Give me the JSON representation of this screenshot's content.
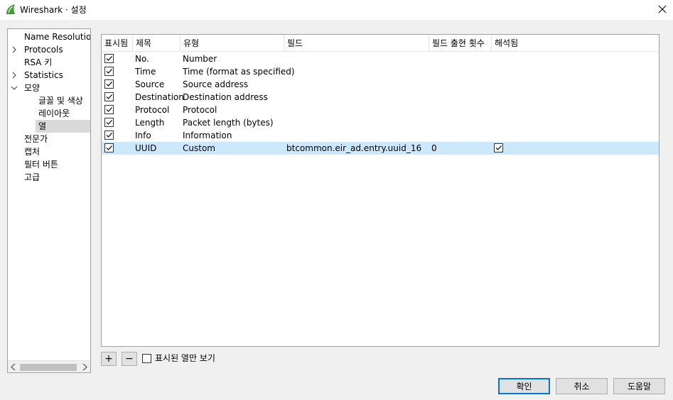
{
  "window": {
    "title": "Wireshark · 설정"
  },
  "tree": {
    "items": [
      {
        "label": "Name Resolution",
        "level": 0,
        "expander": "none",
        "selected": false
      },
      {
        "label": "Protocols",
        "level": 0,
        "expander": "collapsed",
        "selected": false
      },
      {
        "label": "RSA 키",
        "level": 0,
        "expander": "none",
        "selected": false
      },
      {
        "label": "Statistics",
        "level": 0,
        "expander": "collapsed",
        "selected": false
      },
      {
        "label": "모양",
        "level": 0,
        "expander": "expanded",
        "selected": false
      },
      {
        "label": "글꼴 및 색상",
        "level": 1,
        "expander": "none",
        "selected": false
      },
      {
        "label": "레이아웃",
        "level": 1,
        "expander": "none",
        "selected": false
      },
      {
        "label": "열",
        "level": 1,
        "expander": "none",
        "selected": true
      },
      {
        "label": "전문가",
        "level": 0,
        "expander": "none",
        "selected": false
      },
      {
        "label": "캡처",
        "level": 0,
        "expander": "none",
        "selected": false
      },
      {
        "label": "필터 버튼",
        "level": 0,
        "expander": "none",
        "selected": false
      },
      {
        "label": "고급",
        "level": 0,
        "expander": "none",
        "selected": false
      }
    ]
  },
  "columns_table": {
    "headers": [
      "표시됨",
      "제목",
      "유형",
      "필드",
      "필드 출현 횟수",
      "해석됨"
    ],
    "rows": [
      {
        "shown": true,
        "title": "No.",
        "type": "Number",
        "fields": "",
        "occurrence": "",
        "resolved": null,
        "selected": false
      },
      {
        "shown": true,
        "title": "Time",
        "type": "Time (format as specified)",
        "fields": "",
        "occurrence": "",
        "resolved": null,
        "selected": false
      },
      {
        "shown": true,
        "title": "Source",
        "type": "Source address",
        "fields": "",
        "occurrence": "",
        "resolved": null,
        "selected": false
      },
      {
        "shown": true,
        "title": "Destination",
        "type": "Destination address",
        "fields": "",
        "occurrence": "",
        "resolved": null,
        "selected": false
      },
      {
        "shown": true,
        "title": "Protocol",
        "type": "Protocol",
        "fields": "",
        "occurrence": "",
        "resolved": null,
        "selected": false
      },
      {
        "shown": true,
        "title": "Length",
        "type": "Packet length (bytes)",
        "fields": "",
        "occurrence": "",
        "resolved": null,
        "selected": false
      },
      {
        "shown": true,
        "title": "Info",
        "type": "Information",
        "fields": "",
        "occurrence": "",
        "resolved": null,
        "selected": false
      },
      {
        "shown": true,
        "title": "UUID",
        "type": "Custom",
        "fields": "btcommon.eir_ad.entry.uuid_16",
        "occurrence": "0",
        "resolved": true,
        "selected": true
      }
    ]
  },
  "controls": {
    "add_label": "+",
    "remove_label": "−",
    "show_displayed_only_label": "표시된 열만 보기",
    "show_displayed_only_checked": false
  },
  "buttons": {
    "ok": "확인",
    "cancel": "취소",
    "help": "도움말"
  },
  "colors": {
    "selection": "#cce8ff",
    "tree_selection": "#d9d9d9",
    "default_button_border": "#0078d7",
    "app_icon": "#3c9d2f"
  },
  "icons": {
    "app": "wireshark-fin-icon",
    "close": "close-icon",
    "collapsed": "chevron-right-icon",
    "expanded": "chevron-down-icon"
  }
}
